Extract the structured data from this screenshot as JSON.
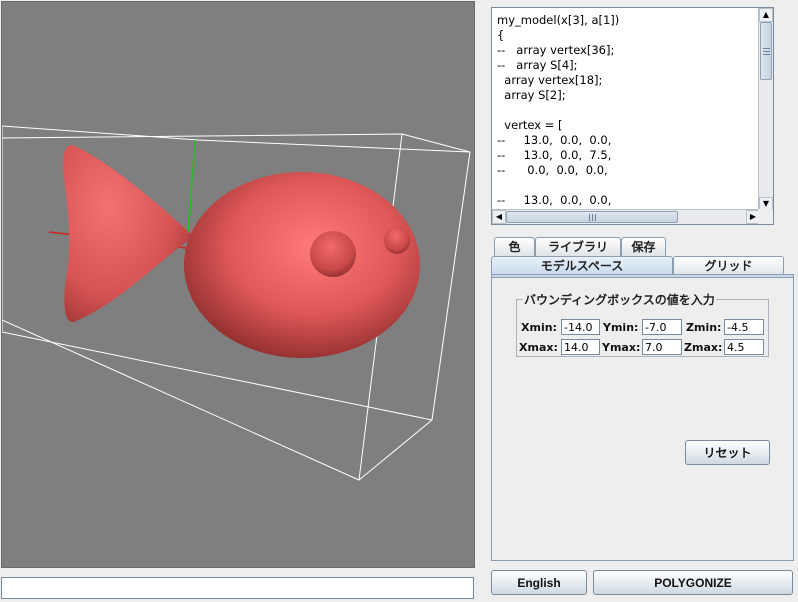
{
  "code": {
    "lines": [
      "my_model(x[3], a[1])",
      "{",
      "--   array vertex[36];",
      "--   array S[4];",
      "  array vertex[18];",
      "  array S[2];",
      "",
      "  vertex = [",
      "--     13.0,  0.0,  0.0,",
      "--     13.0,  0.0,  7.5,",
      "--      0.0,  0.0,  0.0,",
      "",
      "--     13.0,  0.0,  0.0,"
    ]
  },
  "scrollbar": {
    "up": "▲",
    "down": "▼",
    "left": "◀",
    "right": "▶"
  },
  "tabs_top": [
    {
      "label": "色"
    },
    {
      "label": "ライブラリ"
    },
    {
      "label": "保存"
    }
  ],
  "tabs_bottom": [
    {
      "label": "モデルスペース",
      "selected": true
    },
    {
      "label": "グリッド",
      "selected": false
    }
  ],
  "bbox": {
    "legend": "バウンディングボックスの値を入力",
    "xmin_label": "Xmin:",
    "xmin": "-14.0",
    "ymin_label": "Ymin:",
    "ymin": "-7.0",
    "zmin_label": "Zmin:",
    "zmin": "-4.5",
    "xmax_label": "Xmax:",
    "xmax": "14.0",
    "ymax_label": "Ymax:",
    "ymax": "7.0",
    "zmax_label": "Zmax:",
    "zmax": "4.5"
  },
  "buttons": {
    "reset": "リセット",
    "english": "English",
    "polygonize": "POLYGONIZE"
  },
  "command_input": "",
  "colors": {
    "viewport_bg": "#7f7f7f",
    "fish": "#e05c5c",
    "axis_x": "#d02020",
    "axis_y": "#20c020",
    "box": "#ffffff"
  }
}
